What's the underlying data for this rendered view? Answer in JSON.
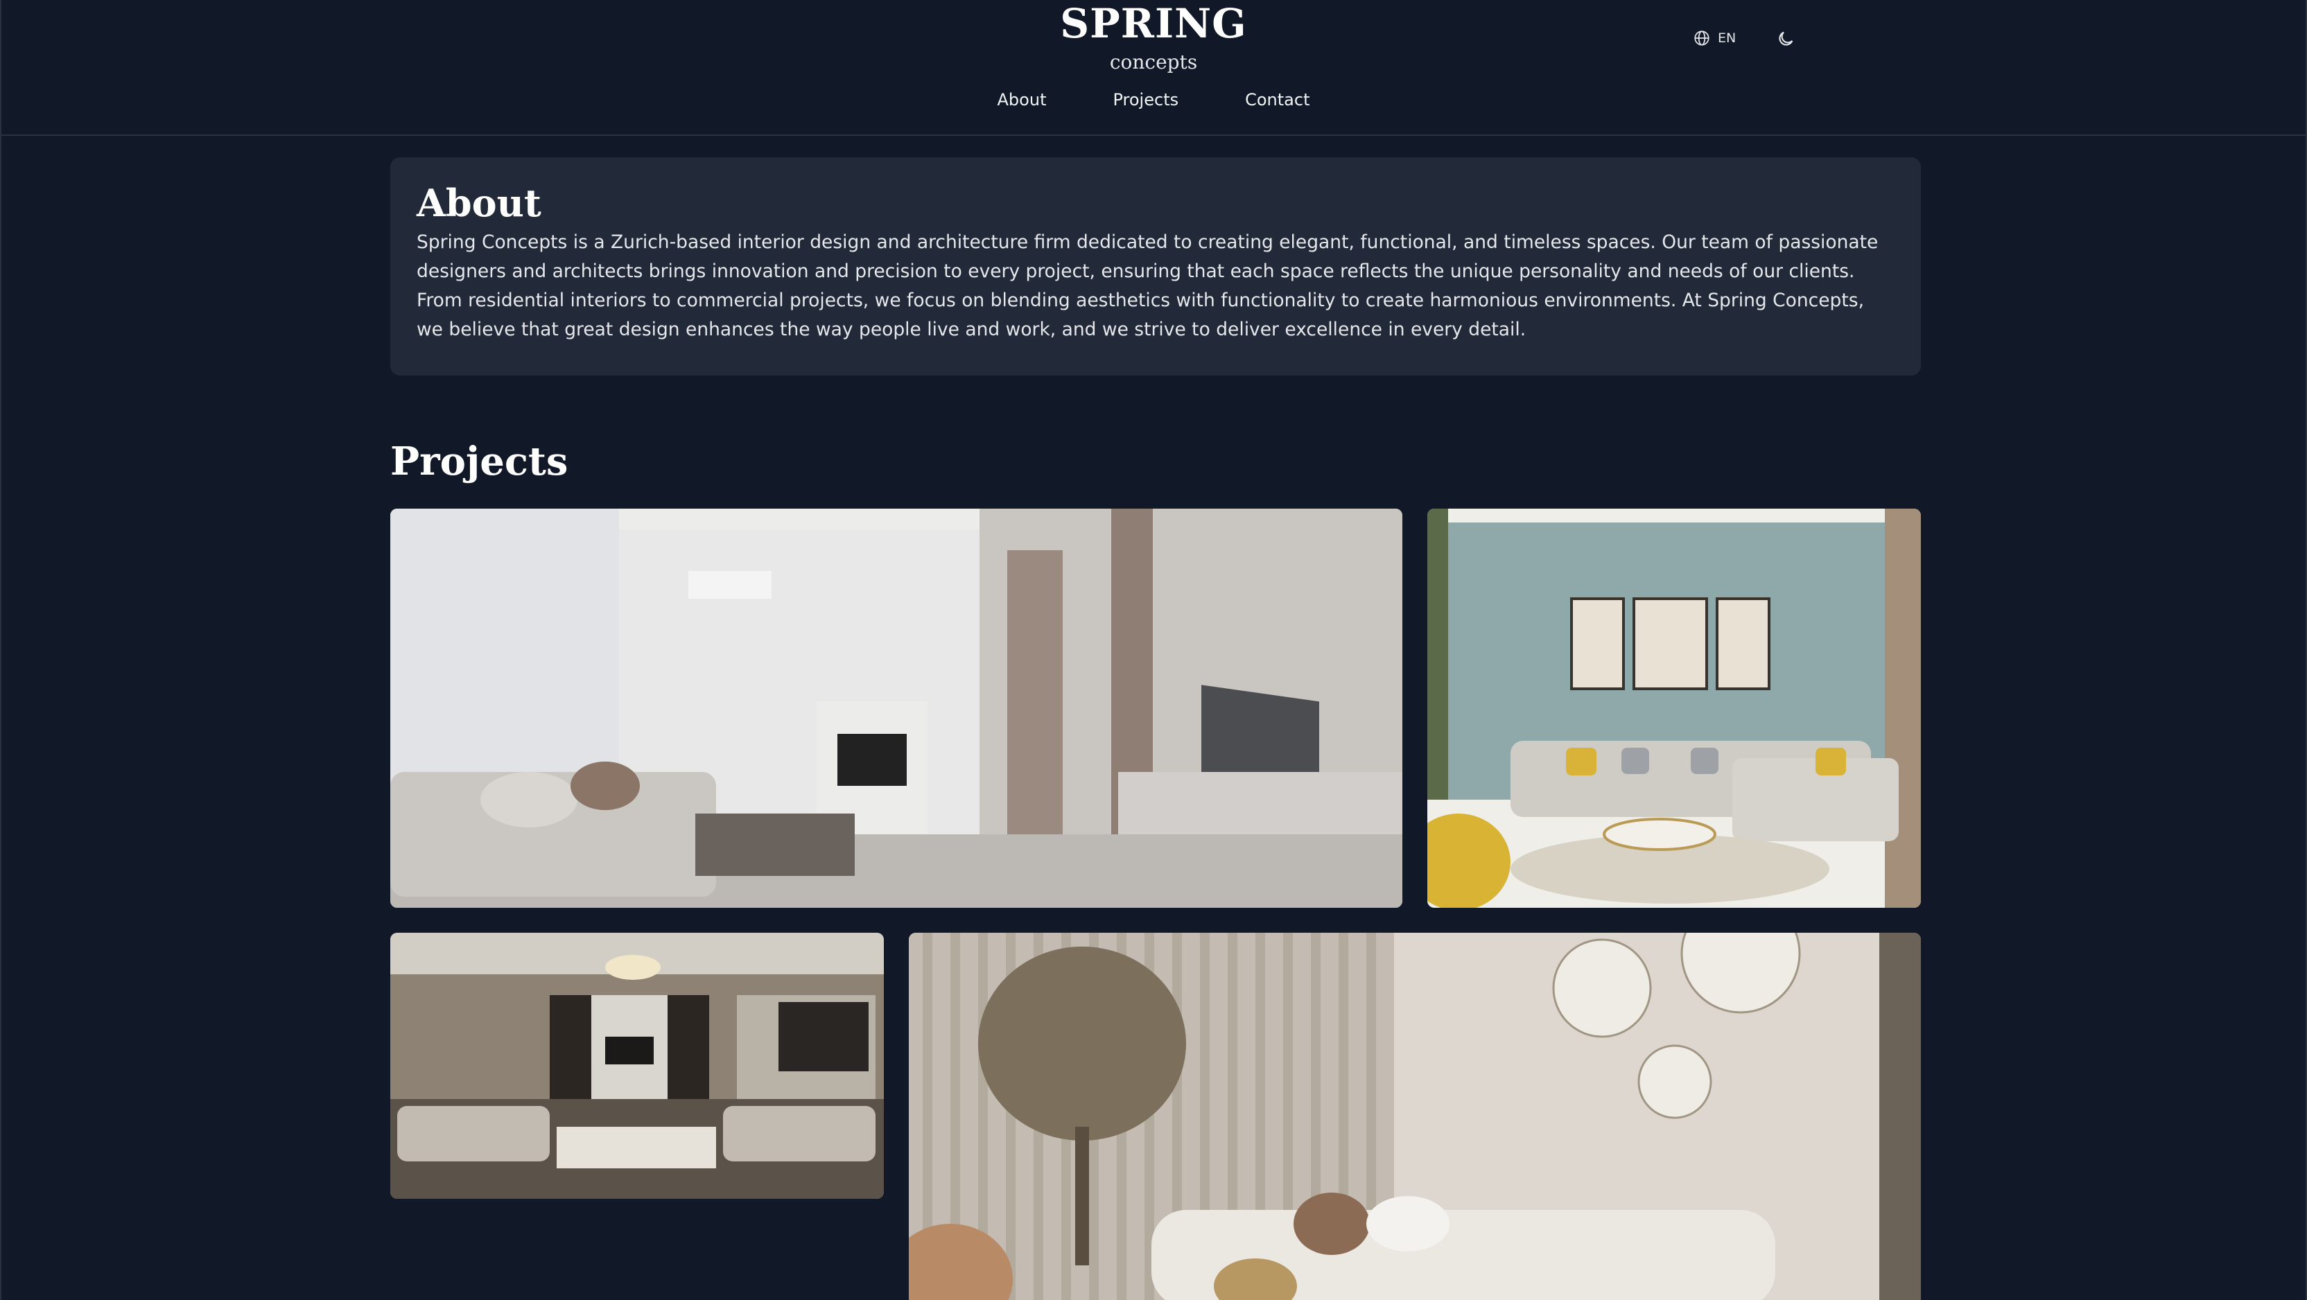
{
  "brand": {
    "title": "SPRING",
    "subtitle": "concepts"
  },
  "nav": {
    "about": "About",
    "projects": "Projects",
    "contact": "Contact"
  },
  "language": {
    "code": "EN",
    "icon": "globe-icon"
  },
  "theme_toggle": {
    "icon": "moon-icon"
  },
  "about": {
    "title": "About",
    "text": "Spring Concepts is a Zurich-based interior design and architecture firm dedicated to creating elegant, functional, and timeless spaces. Our team of passionate designers and architects brings innovation and precision to every project, ensuring that each space reflects the unique personality and needs of our clients. From residential interiors to commercial projects, we focus on blending aesthetics with functionality to create harmonious environments. At Spring Concepts, we believe that great design enhances the way people live and work, and we strive to deliver excellence in every detail."
  },
  "projects": {
    "title": "Projects"
  },
  "colors": {
    "background": "#111827",
    "card": "#222938",
    "text": "#e5e7eb",
    "heading": "#ffffff"
  }
}
